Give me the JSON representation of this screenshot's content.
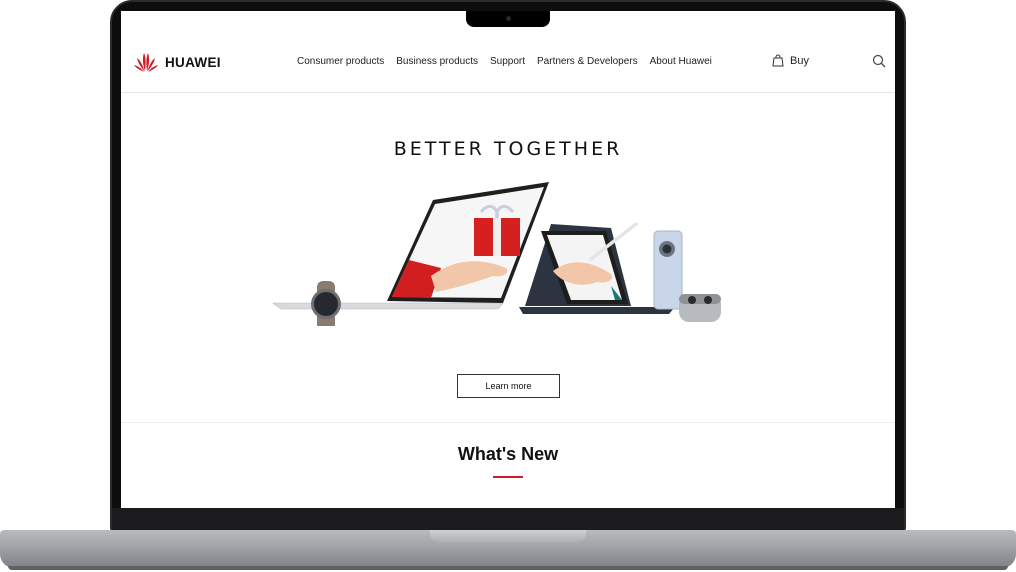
{
  "brand": {
    "name": "HUAWEI",
    "accent": "#cf1c2a"
  },
  "nav": {
    "items": [
      {
        "label": "Consumer products"
      },
      {
        "label": "Business products"
      },
      {
        "label": "Support"
      },
      {
        "label": "Partners & Developers"
      },
      {
        "label": "About Huawei"
      }
    ]
  },
  "header": {
    "buy_label": "Buy",
    "buy_icon": "shopping-bag-icon",
    "search_icon": "search-icon"
  },
  "hero": {
    "title": "BETTER TOGETHER",
    "cta_label": "Learn more"
  },
  "section": {
    "title": "What's New"
  }
}
